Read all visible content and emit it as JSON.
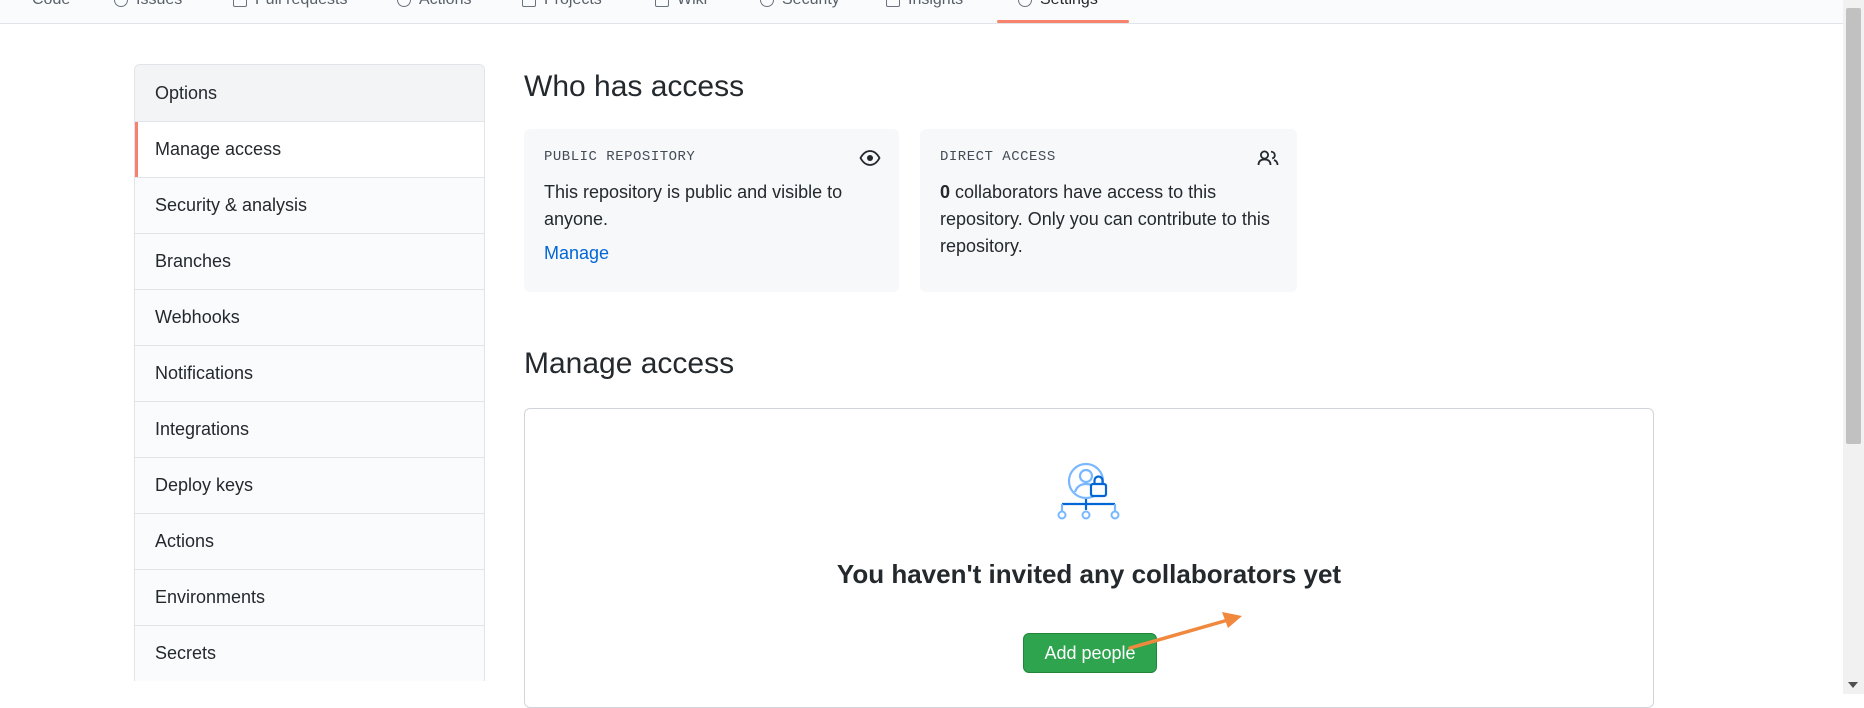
{
  "topnav": {
    "tabs": [
      "Code",
      "Issues",
      "Pull requests",
      "Actions",
      "Projects",
      "Wiki",
      "Security",
      "Insights",
      "Settings"
    ],
    "active": "Settings"
  },
  "sidebar": {
    "items": [
      {
        "label": "Options"
      },
      {
        "label": "Manage access"
      },
      {
        "label": "Security & analysis"
      },
      {
        "label": "Branches"
      },
      {
        "label": "Webhooks"
      },
      {
        "label": "Notifications"
      },
      {
        "label": "Integrations"
      },
      {
        "label": "Deploy keys"
      },
      {
        "label": "Actions"
      },
      {
        "label": "Environments"
      },
      {
        "label": "Secrets"
      }
    ],
    "selected": "Manage access"
  },
  "who_has_access": {
    "title": "Who has access",
    "public_card": {
      "label": "PUBLIC REPOSITORY",
      "description": "This repository is public and visible to anyone.",
      "link": "Manage",
      "icon": "eye-icon"
    },
    "direct_card": {
      "label": "DIRECT ACCESS",
      "count": "0",
      "description": " collaborators have access to this repository. Only you can contribute to this repository.",
      "icon": "people-icon"
    }
  },
  "manage_access": {
    "title": "Manage access",
    "empty_icon": "collaborators-lock-icon",
    "empty_message": "You haven't invited any collaborators yet",
    "add_button": "Add people"
  },
  "colors": {
    "accent": "#f9826c",
    "link": "#0366d6",
    "button_green": "#2ea44f",
    "illustration_blue": "#79b8ff",
    "annotation_arrow": "#f0883e"
  }
}
